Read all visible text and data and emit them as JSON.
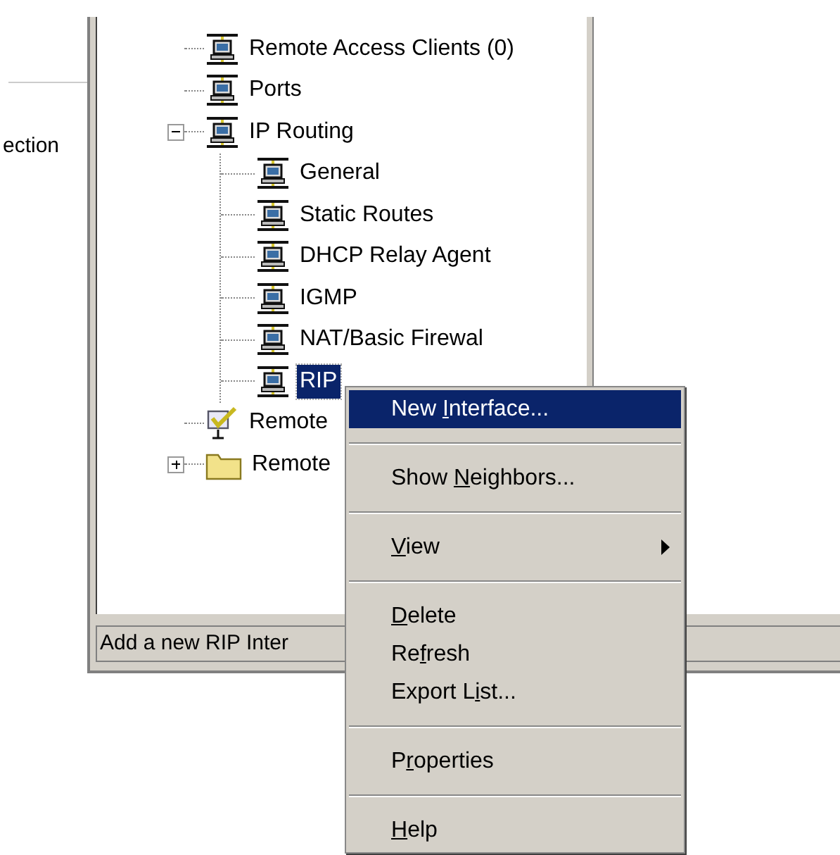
{
  "left_pane": {
    "label": "ection"
  },
  "tree": [
    {
      "label": "Remote Access Clients (0)",
      "kind": "network",
      "selected": false
    },
    {
      "label": "Ports",
      "kind": "network",
      "selected": false
    },
    {
      "label": "IP Routing",
      "kind": "network",
      "selected": false,
      "expanded": true,
      "children": [
        {
          "label": "General",
          "kind": "network",
          "selected": false
        },
        {
          "label": "Static Routes",
          "kind": "network",
          "selected": false
        },
        {
          "label": "DHCP Relay Agent",
          "kind": "network",
          "selected": false
        },
        {
          "label": "IGMP",
          "kind": "network",
          "selected": false
        },
        {
          "label": "NAT/Basic Firewal",
          "kind": "network",
          "selected": false
        },
        {
          "label": "RIP",
          "kind": "network",
          "selected": true
        }
      ]
    },
    {
      "label": "Remote",
      "kind": "policy",
      "selected": false
    },
    {
      "label": "Remote",
      "kind": "folder",
      "selected": false,
      "expanded": false
    }
  ],
  "status_bar": "Add a new RIP Inter",
  "context_menu": [
    {
      "kind": "item",
      "before": "New ",
      "key": "I",
      "after": "nterface...",
      "selected": true
    },
    {
      "kind": "separator"
    },
    {
      "kind": "item",
      "before": "Show ",
      "key": "N",
      "after": "eighbors...",
      "selected": false
    },
    {
      "kind": "separator"
    },
    {
      "kind": "submenu",
      "key": "V",
      "after": "iew",
      "selected": false
    },
    {
      "kind": "separator"
    },
    {
      "kind": "item",
      "key": "D",
      "after": "elete",
      "selected": false
    },
    {
      "kind": "item",
      "before": "Re",
      "key": "f",
      "after": "resh",
      "selected": false
    },
    {
      "kind": "item",
      "before": "Export L",
      "key": "i",
      "after": "st...",
      "selected": false
    },
    {
      "kind": "separator"
    },
    {
      "kind": "item",
      "before": "P",
      "key": "r",
      "after": "operties",
      "selected": false
    },
    {
      "kind": "separator"
    },
    {
      "kind": "item",
      "key": "H",
      "after": "elp",
      "selected": false
    }
  ]
}
